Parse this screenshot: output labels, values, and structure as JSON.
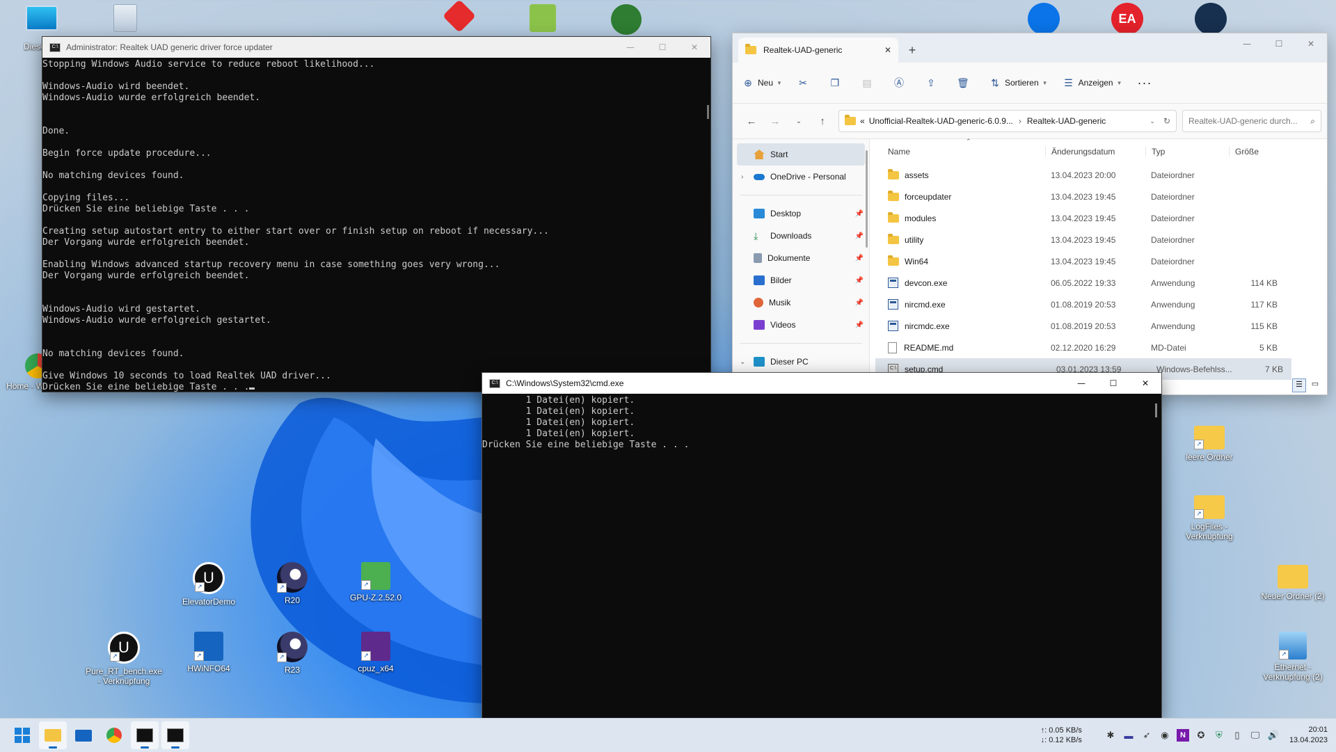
{
  "desktop": {
    "icons": [
      {
        "name": "dieser-pc",
        "label": "Dieser PC"
      },
      {
        "name": "home-workday",
        "label": "Home - Workday"
      },
      {
        "name": "elevatordemo",
        "label": "ElevatorDemo"
      },
      {
        "name": "r20",
        "label": "R20"
      },
      {
        "name": "gpuz",
        "label": "GPU-Z.2.52.0"
      },
      {
        "name": "pure-rt",
        "label": "Pure_RT_bench.exe - Verknüpfung"
      },
      {
        "name": "hwinfo64",
        "label": "HWiNFO64"
      },
      {
        "name": "r23",
        "label": "R23"
      },
      {
        "name": "cpuz",
        "label": "cpuz_x64"
      },
      {
        "name": "leere-ordner",
        "label": "leere Ordner"
      },
      {
        "name": "logfiles",
        "label": "LogFiles - Verknüpfung"
      },
      {
        "name": "neuer-ordner",
        "label": "Neuer Ordner (2)"
      },
      {
        "name": "ethernet",
        "label": "Ethernet - Verknüpfung (2)"
      }
    ]
  },
  "console1": {
    "title": "Administrator:  Realtek UAD generic driver force updater",
    "lines": [
      "Stopping Windows Audio service to reduce reboot likelihood...",
      "",
      "Windows-Audio wird beendet.",
      "Windows-Audio wurde erfolgreich beendet.",
      "",
      "",
      "Done.",
      "",
      "Begin force update procedure...",
      "",
      "No matching devices found.",
      "",
      "Copying files...",
      "Drücken Sie eine beliebige Taste . . .",
      "",
      "Creating setup autostart entry to either start over or finish setup on reboot if necessary...",
      "Der Vorgang wurde erfolgreich beendet.",
      "",
      "Enabling Windows advanced startup recovery menu in case something goes very wrong...",
      "Der Vorgang wurde erfolgreich beendet.",
      "",
      "",
      "Windows-Audio wird gestartet.",
      "Windows-Audio wurde erfolgreich gestartet.",
      "",
      "",
      "No matching devices found.",
      "",
      "Give Windows 10 seconds to load Realtek UAD driver...",
      "Drücken Sie eine beliebige Taste . . ."
    ]
  },
  "console2": {
    "title": "C:\\Windows\\System32\\cmd.exe",
    "lines": [
      "        1 Datei(en) kopiert.",
      "        1 Datei(en) kopiert.",
      "        1 Datei(en) kopiert.",
      "        1 Datei(en) kopiert.",
      "Drücken Sie eine beliebige Taste . . ."
    ]
  },
  "explorer": {
    "tab_title": "Realtek-UAD-generic",
    "cmd": {
      "new": "Neu",
      "sort": "Sortieren",
      "view": "Anzeigen"
    },
    "breadcrumb": [
      "Unofficial-Realtek-UAD-generic-6.0.9...",
      "Realtek-UAD-generic"
    ],
    "search_placeholder": "Realtek-UAD-generic durch...",
    "sidebar": {
      "start": "Start",
      "onedrive": "OneDrive - Personal",
      "pinned": [
        "Desktop",
        "Downloads",
        "Dokumente",
        "Bilder",
        "Musik",
        "Videos"
      ],
      "thispc": "Dieser PC"
    },
    "columns": {
      "name": "Name",
      "date": "Änderungsdatum",
      "type": "Typ",
      "size": "Größe"
    },
    "files": [
      {
        "name": "assets",
        "date": "13.04.2023 20:00",
        "type": "Dateiordner",
        "size": "",
        "kind": "folder"
      },
      {
        "name": "forceupdater",
        "date": "13.04.2023 19:45",
        "type": "Dateiordner",
        "size": "",
        "kind": "folder"
      },
      {
        "name": "modules",
        "date": "13.04.2023 19:45",
        "type": "Dateiordner",
        "size": "",
        "kind": "folder"
      },
      {
        "name": "utility",
        "date": "13.04.2023 19:45",
        "type": "Dateiordner",
        "size": "",
        "kind": "folder"
      },
      {
        "name": "Win64",
        "date": "13.04.2023 19:45",
        "type": "Dateiordner",
        "size": "",
        "kind": "folder"
      },
      {
        "name": "devcon.exe",
        "date": "06.05.2022 19:33",
        "type": "Anwendung",
        "size": "114 KB",
        "kind": "exe"
      },
      {
        "name": "nircmd.exe",
        "date": "01.08.2019 20:53",
        "type": "Anwendung",
        "size": "117 KB",
        "kind": "exe"
      },
      {
        "name": "nircmdc.exe",
        "date": "01.08.2019 20:53",
        "type": "Anwendung",
        "size": "115 KB",
        "kind": "exe"
      },
      {
        "name": "README.md",
        "date": "02.12.2020 16:29",
        "type": "MD-Datei",
        "size": "5 KB",
        "kind": "md"
      },
      {
        "name": "setup.cmd",
        "date": "03.01.2023 13:59",
        "type": "Windows-Befehlss...",
        "size": "7 KB",
        "kind": "cmd"
      }
    ]
  },
  "taskbar": {
    "net_up": "↑: 0.05 KB/s",
    "net_down": "↓: 0.12 KB/s",
    "time": "20:01",
    "date": "13.04.2023"
  }
}
